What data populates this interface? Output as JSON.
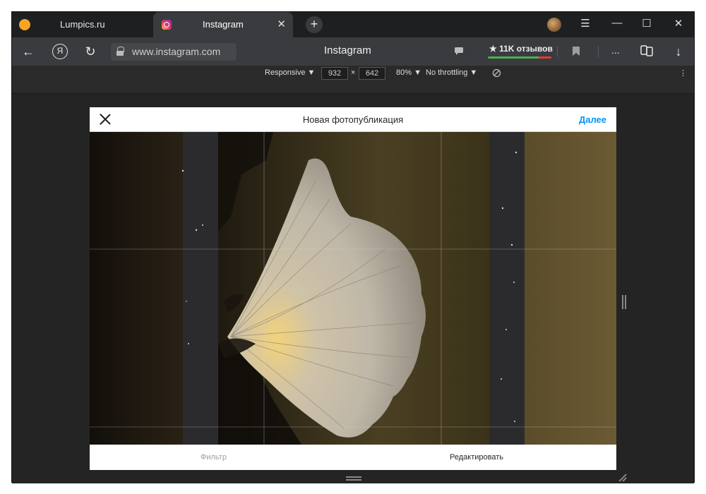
{
  "tabs": [
    {
      "label": "Lumpics.ru",
      "icon": "lumpics-favicon-icon"
    },
    {
      "label": "Instagram",
      "icon": "instagram-favicon-icon",
      "close": "✕"
    }
  ],
  "newtab": "+",
  "window_controls": {
    "menu": "☰",
    "minimize": "—",
    "maximize": "☐",
    "close": "✕"
  },
  "nav": {
    "back": "←",
    "yandex": "Я",
    "reload": "↻",
    "url": "www.instagram.com",
    "page_title": "Instagram",
    "reviews": "★ 11K отзывов",
    "more": "...",
    "download": "↓"
  },
  "devtools": {
    "device": "Responsive",
    "width": "932",
    "times": "×",
    "height": "642",
    "zoom": "80%",
    "throttle": "No throttling",
    "more": "⋮"
  },
  "modal": {
    "title": "Новая фотопубликация",
    "next": "Далее",
    "filter_tab": "Фильтр",
    "edit_tab": "Редактировать"
  },
  "colors": {
    "accent": "#0095f6",
    "tab_bg": "#1e1f21",
    "active_tab": "#3a3b3e"
  }
}
